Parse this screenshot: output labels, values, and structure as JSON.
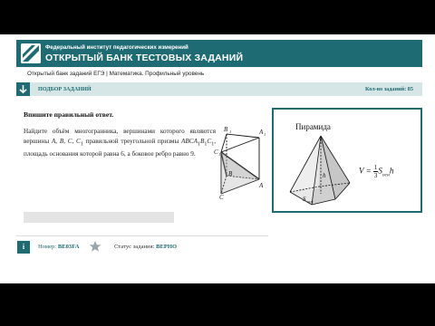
{
  "header": {
    "subtitle": "Федеральный институт педагогических измерений",
    "title": "ОТКРЫТЫЙ БАНК ТЕСТОВЫХ ЗАДАНИЙ"
  },
  "breadcrumb": "Открытый банк заданий ЕГЭ | Математика. Профильный уровень",
  "selection_bar": {
    "label": "ПОДБОР ЗАДАНИЙ",
    "count": "Кол-во заданий: 85"
  },
  "task": {
    "prompt": "Впишите правильный ответ.",
    "text_1": "Найдите объём многогранника, вершинами которого являются вершины ",
    "vertices": "A, B, C, C",
    "vertices_sub": "1",
    "text_2": " правильной треугольной призмы ",
    "prism": "ABCA",
    "text_3": ", площадь основания которой равна 6, а боковое ребро равно 9."
  },
  "figure_labels": {
    "B1": "B",
    "A1": "A",
    "C1": "C",
    "B": "B",
    "A": "A",
    "C": "C"
  },
  "reference": {
    "title": "Пирамида",
    "h": "h",
    "s_label": "S",
    "s_sub": "осн",
    "formula_v": "V",
    "formula_num": "1",
    "formula_den": "3",
    "formula_s": "S",
    "formula_sub": "осн",
    "formula_h": "h"
  },
  "footer": {
    "info": "i",
    "number_label": "Номер:",
    "number_value": "BE03FA",
    "status_label": "Статус задания:",
    "status_value": "ВЕРНО"
  },
  "colors": {
    "accent": "#1f6b73",
    "bar_bg": "#d6e6e6"
  }
}
